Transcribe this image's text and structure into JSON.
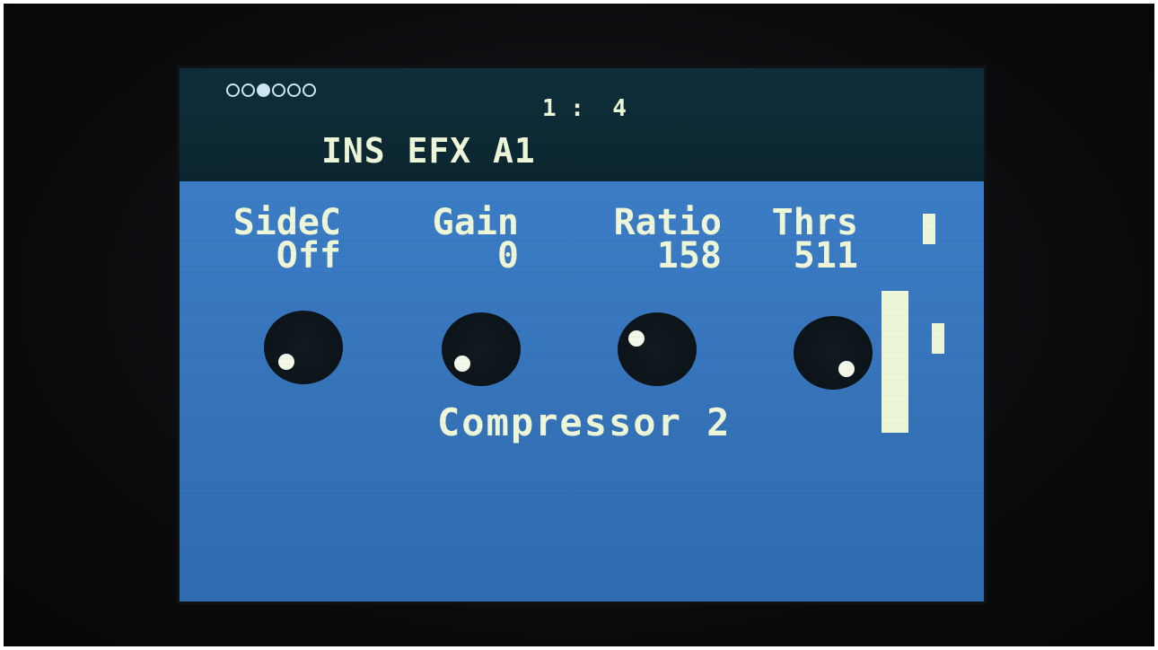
{
  "header": {
    "page_indicator": {
      "count": 6,
      "active_index": 2
    },
    "position": "1 :  4",
    "title": "INS EFX A1"
  },
  "params": [
    {
      "label": "SideC",
      "value": "Off",
      "knob_fraction": 0.0
    },
    {
      "label": "Gain",
      "value": "0",
      "knob_fraction": 0.0
    },
    {
      "label": "Ratio",
      "value": "158",
      "knob_fraction": 0.3
    },
    {
      "label": "Thrs",
      "value": "511",
      "knob_fraction": 1.0
    }
  ],
  "effect_name": "Compressor 2",
  "colors": {
    "screen_blue": "#3a7bc4",
    "header_dark": "#0b2630",
    "text": "#eef6d8",
    "knob": "#0a1216"
  },
  "icons": [
    "page-dot-icon",
    "knob-icon",
    "scroll-bar-icon",
    "level-meter-icon"
  ]
}
